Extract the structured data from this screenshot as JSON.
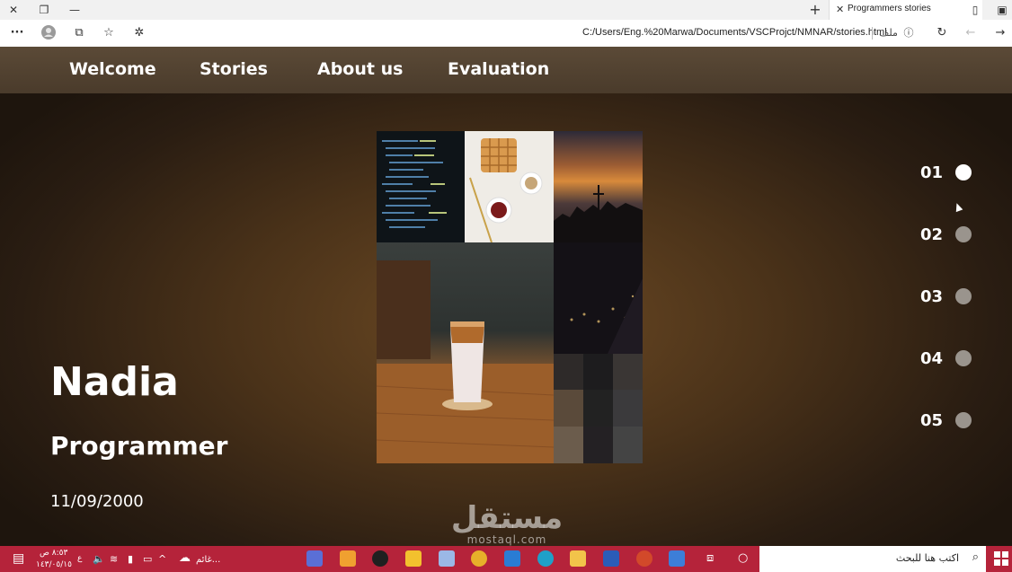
{
  "browser": {
    "tab_title": "Programmers stories",
    "url": "C:/Users/Eng.%20Marwa/Documents/VSCProjct/NMNAR/stories.html",
    "file_label": "ملف",
    "more_label": "···"
  },
  "nav": {
    "items": [
      "Welcome",
      "Stories",
      "About us",
      "Evaluation"
    ]
  },
  "profile": {
    "name": "Nadia",
    "role": "Programmer",
    "date": "11/09/2000"
  },
  "slides": {
    "numbers": [
      "01",
      "02",
      "03",
      "04",
      "05"
    ],
    "active_index": 0
  },
  "watermark": {
    "arabic": "مستقل",
    "latin": "mostaql.com"
  },
  "taskbar": {
    "search_placeholder": "اكتب هنا للبحث",
    "weather": "غائم...",
    "time": "٨:٥٣ ص",
    "date": "١٤٣/٠٥/١٥",
    "lang": "ع"
  },
  "colors": {
    "nav_bg": "#54432f",
    "taskbar_bg": "#b5233a",
    "dot_active": "#ffffff",
    "dot_inactive": "#9a948d"
  }
}
